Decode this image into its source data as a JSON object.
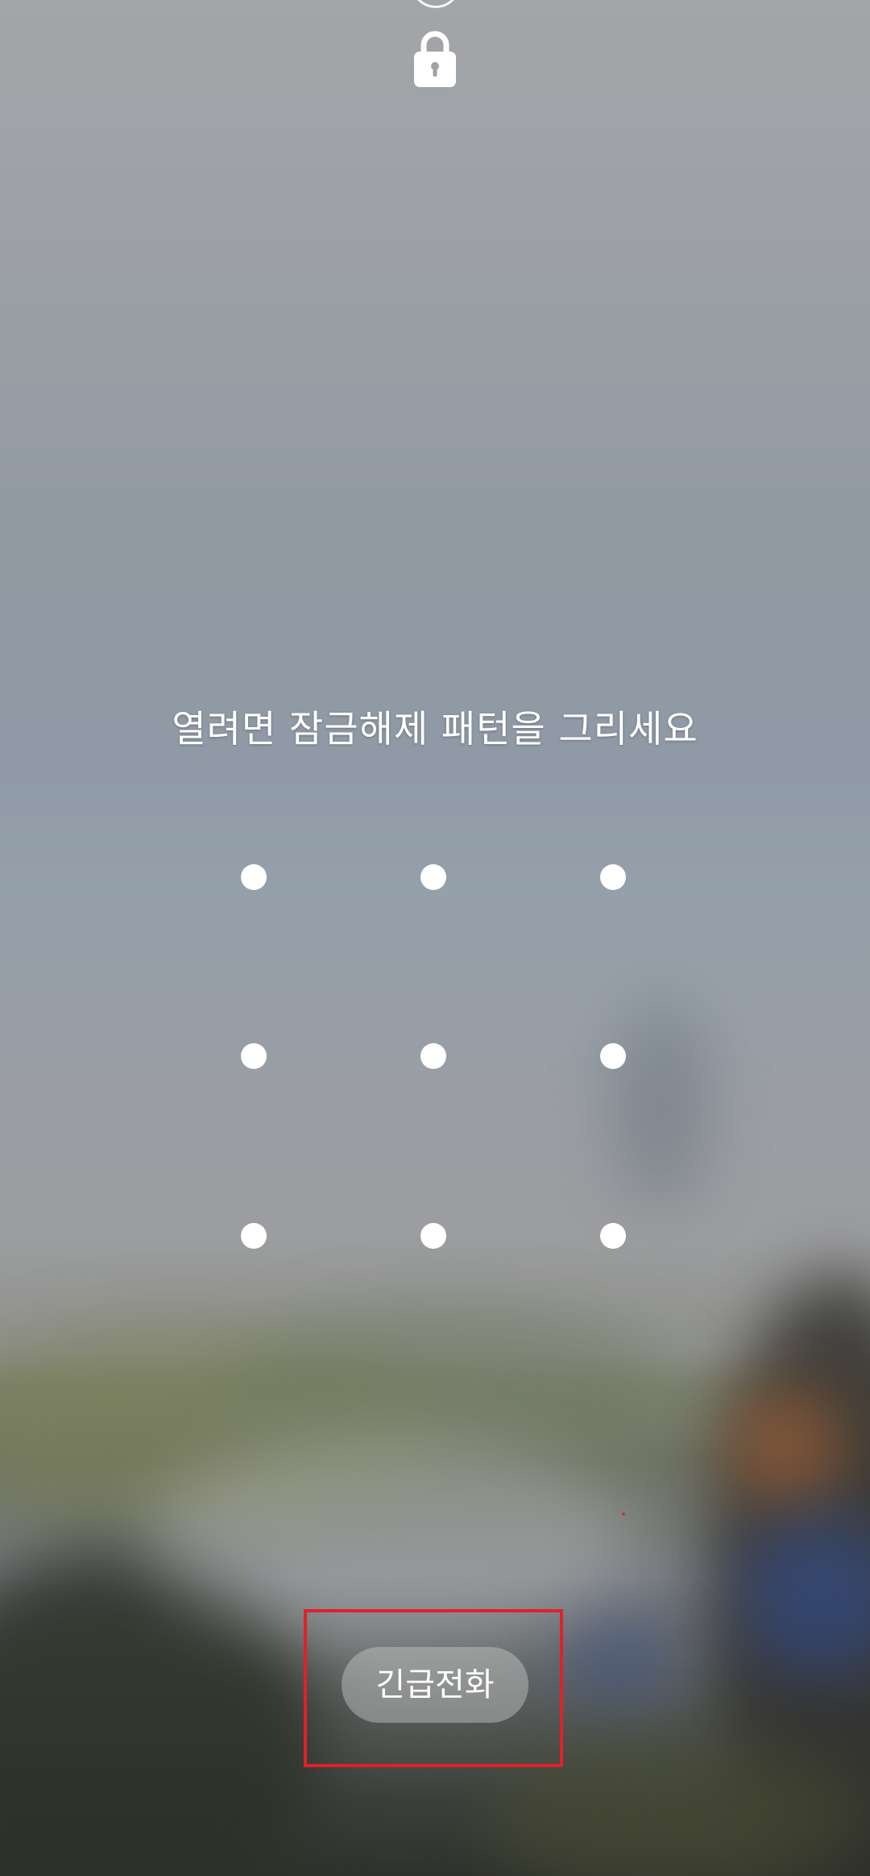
{
  "lock_screen": {
    "lock_icon": "lock-icon",
    "instruction": "열려면 잠금해제 패턴을 그리세요",
    "pattern_dots": 9,
    "emergency_call_label": "긴급전화"
  },
  "colors": {
    "text": "#ffffff",
    "highlight_border": "#e0212b"
  }
}
